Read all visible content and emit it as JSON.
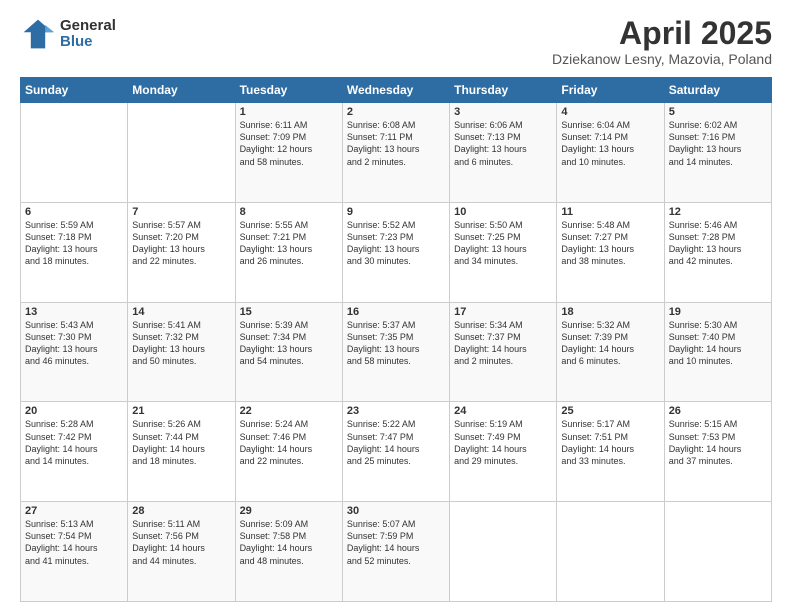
{
  "logo": {
    "general": "General",
    "blue": "Blue"
  },
  "title": {
    "main": "April 2025",
    "sub": "Dziekanow Lesny, Mazovia, Poland"
  },
  "days_of_week": [
    "Sunday",
    "Monday",
    "Tuesday",
    "Wednesday",
    "Thursday",
    "Friday",
    "Saturday"
  ],
  "weeks": [
    [
      {
        "day": "",
        "info": ""
      },
      {
        "day": "",
        "info": ""
      },
      {
        "day": "1",
        "info": "Sunrise: 6:11 AM\nSunset: 7:09 PM\nDaylight: 12 hours\nand 58 minutes."
      },
      {
        "day": "2",
        "info": "Sunrise: 6:08 AM\nSunset: 7:11 PM\nDaylight: 13 hours\nand 2 minutes."
      },
      {
        "day": "3",
        "info": "Sunrise: 6:06 AM\nSunset: 7:13 PM\nDaylight: 13 hours\nand 6 minutes."
      },
      {
        "day": "4",
        "info": "Sunrise: 6:04 AM\nSunset: 7:14 PM\nDaylight: 13 hours\nand 10 minutes."
      },
      {
        "day": "5",
        "info": "Sunrise: 6:02 AM\nSunset: 7:16 PM\nDaylight: 13 hours\nand 14 minutes."
      }
    ],
    [
      {
        "day": "6",
        "info": "Sunrise: 5:59 AM\nSunset: 7:18 PM\nDaylight: 13 hours\nand 18 minutes."
      },
      {
        "day": "7",
        "info": "Sunrise: 5:57 AM\nSunset: 7:20 PM\nDaylight: 13 hours\nand 22 minutes."
      },
      {
        "day": "8",
        "info": "Sunrise: 5:55 AM\nSunset: 7:21 PM\nDaylight: 13 hours\nand 26 minutes."
      },
      {
        "day": "9",
        "info": "Sunrise: 5:52 AM\nSunset: 7:23 PM\nDaylight: 13 hours\nand 30 minutes."
      },
      {
        "day": "10",
        "info": "Sunrise: 5:50 AM\nSunset: 7:25 PM\nDaylight: 13 hours\nand 34 minutes."
      },
      {
        "day": "11",
        "info": "Sunrise: 5:48 AM\nSunset: 7:27 PM\nDaylight: 13 hours\nand 38 minutes."
      },
      {
        "day": "12",
        "info": "Sunrise: 5:46 AM\nSunset: 7:28 PM\nDaylight: 13 hours\nand 42 minutes."
      }
    ],
    [
      {
        "day": "13",
        "info": "Sunrise: 5:43 AM\nSunset: 7:30 PM\nDaylight: 13 hours\nand 46 minutes."
      },
      {
        "day": "14",
        "info": "Sunrise: 5:41 AM\nSunset: 7:32 PM\nDaylight: 13 hours\nand 50 minutes."
      },
      {
        "day": "15",
        "info": "Sunrise: 5:39 AM\nSunset: 7:34 PM\nDaylight: 13 hours\nand 54 minutes."
      },
      {
        "day": "16",
        "info": "Sunrise: 5:37 AM\nSunset: 7:35 PM\nDaylight: 13 hours\nand 58 minutes."
      },
      {
        "day": "17",
        "info": "Sunrise: 5:34 AM\nSunset: 7:37 PM\nDaylight: 14 hours\nand 2 minutes."
      },
      {
        "day": "18",
        "info": "Sunrise: 5:32 AM\nSunset: 7:39 PM\nDaylight: 14 hours\nand 6 minutes."
      },
      {
        "day": "19",
        "info": "Sunrise: 5:30 AM\nSunset: 7:40 PM\nDaylight: 14 hours\nand 10 minutes."
      }
    ],
    [
      {
        "day": "20",
        "info": "Sunrise: 5:28 AM\nSunset: 7:42 PM\nDaylight: 14 hours\nand 14 minutes."
      },
      {
        "day": "21",
        "info": "Sunrise: 5:26 AM\nSunset: 7:44 PM\nDaylight: 14 hours\nand 18 minutes."
      },
      {
        "day": "22",
        "info": "Sunrise: 5:24 AM\nSunset: 7:46 PM\nDaylight: 14 hours\nand 22 minutes."
      },
      {
        "day": "23",
        "info": "Sunrise: 5:22 AM\nSunset: 7:47 PM\nDaylight: 14 hours\nand 25 minutes."
      },
      {
        "day": "24",
        "info": "Sunrise: 5:19 AM\nSunset: 7:49 PM\nDaylight: 14 hours\nand 29 minutes."
      },
      {
        "day": "25",
        "info": "Sunrise: 5:17 AM\nSunset: 7:51 PM\nDaylight: 14 hours\nand 33 minutes."
      },
      {
        "day": "26",
        "info": "Sunrise: 5:15 AM\nSunset: 7:53 PM\nDaylight: 14 hours\nand 37 minutes."
      }
    ],
    [
      {
        "day": "27",
        "info": "Sunrise: 5:13 AM\nSunset: 7:54 PM\nDaylight: 14 hours\nand 41 minutes."
      },
      {
        "day": "28",
        "info": "Sunrise: 5:11 AM\nSunset: 7:56 PM\nDaylight: 14 hours\nand 44 minutes."
      },
      {
        "day": "29",
        "info": "Sunrise: 5:09 AM\nSunset: 7:58 PM\nDaylight: 14 hours\nand 48 minutes."
      },
      {
        "day": "30",
        "info": "Sunrise: 5:07 AM\nSunset: 7:59 PM\nDaylight: 14 hours\nand 52 minutes."
      },
      {
        "day": "",
        "info": ""
      },
      {
        "day": "",
        "info": ""
      },
      {
        "day": "",
        "info": ""
      }
    ]
  ]
}
